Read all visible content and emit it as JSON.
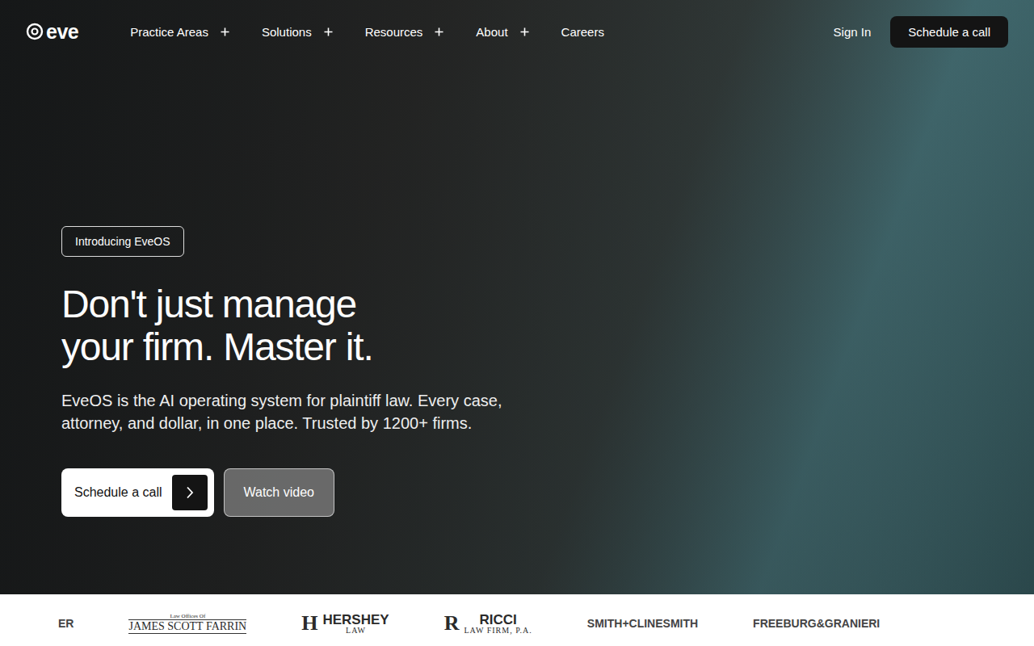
{
  "logo": {
    "text": "eve"
  },
  "nav": {
    "items": [
      {
        "label": "Practice Areas",
        "expandable": true
      },
      {
        "label": "Solutions",
        "expandable": true
      },
      {
        "label": "Resources",
        "expandable": true
      },
      {
        "label": "About",
        "expandable": true
      },
      {
        "label": "Careers",
        "expandable": false
      }
    ],
    "sign_in": "Sign In",
    "cta": "Schedule a call"
  },
  "hero": {
    "badge": "Introducing EveOS",
    "headline": [
      "Don't just manage",
      "your firm. Master it."
    ],
    "subtitle": "EveOS is the AI operating system for plaintiff law. Every case, attorney, and dollar, in one place. Trusted by 1200+ firms.",
    "primary_button": {
      "label": "Schedule a call"
    },
    "secondary_button": {
      "label": "Watch video"
    }
  },
  "logos": [
    {
      "kind": "plain",
      "mark": "",
      "top": "",
      "main": "ER",
      "sub": ""
    },
    {
      "kind": "serif",
      "mark": "",
      "top": "Law Offices Of",
      "main": "JAMES SCOTT FARRIN",
      "sub": ""
    },
    {
      "kind": "mark",
      "mark": "H",
      "top": "",
      "main": "HERSHEY",
      "sub": "LAW"
    },
    {
      "kind": "mark",
      "mark": "R",
      "top": "",
      "main": "RICCI",
      "sub": "LAW FIRM, P.A."
    },
    {
      "kind": "plain",
      "mark": "",
      "top": "",
      "main": "SMITH+CLINESMITH",
      "sub": ""
    },
    {
      "kind": "plain",
      "mark": "",
      "top": "",
      "main": "FREEBURG&GRANIERI",
      "sub": ""
    }
  ]
}
